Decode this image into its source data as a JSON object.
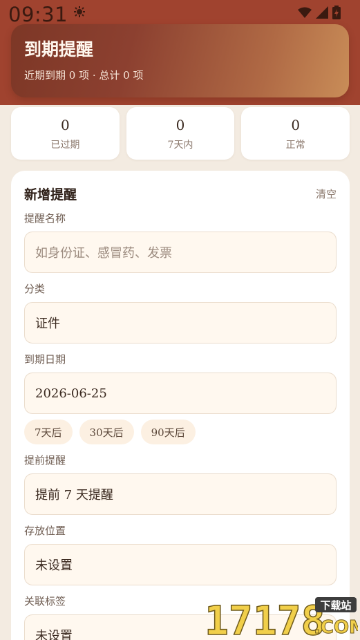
{
  "status_bar": {
    "time": "09:31"
  },
  "hero": {
    "title": "到期提醒",
    "subtitle": "近期到期 0 项 · 总计 0 项"
  },
  "stats": [
    {
      "value": "0",
      "label": "已过期"
    },
    {
      "value": "0",
      "label": "7天内"
    },
    {
      "value": "0",
      "label": "正常"
    }
  ],
  "form": {
    "title": "新增提醒",
    "clear_label": "清空",
    "name_label": "提醒名称",
    "name_placeholder": "如身份证、感冒药、发票",
    "category_label": "分类",
    "category_value": "证件",
    "date_label": "到期日期",
    "date_value": "2026-06-25",
    "quick_dates": [
      "7天后",
      "30天后",
      "90天后"
    ],
    "advance_label": "提前提醒",
    "advance_value": "提前 7 天提醒",
    "location_label": "存放位置",
    "location_value": "未设置",
    "tags_label": "关联标签",
    "tags_value": "未设置"
  },
  "watermark": {
    "number": "17178",
    "domain": ".COM",
    "badge": "下载站"
  },
  "colors": {
    "header_band": "#a0432f",
    "hero_start": "#7d3726",
    "hero_end": "#c98d58",
    "page_background": "#f3ebe1",
    "input_background": "#fff8ef",
    "chip_background": "#fcf0e2"
  }
}
